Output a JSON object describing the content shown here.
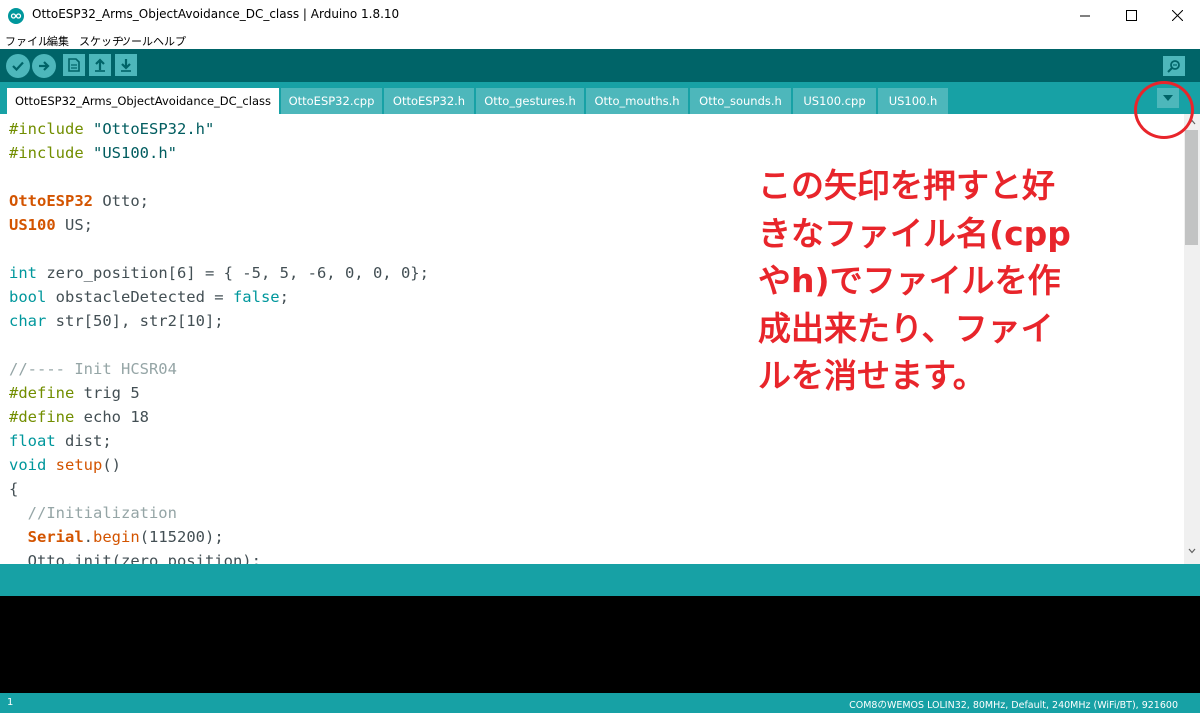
{
  "window": {
    "title": "OttoESP32_Arms_ObjectAvoidance_DC_class | Arduino 1.8.10",
    "app_icon": "arduino-logo-icon",
    "controls": [
      "minimize-icon",
      "maximize-icon",
      "close-icon"
    ]
  },
  "menu": {
    "items": [
      "ファイル",
      "編集",
      "スケッチ",
      "ツール",
      "ヘルプ"
    ]
  },
  "toolbar": {
    "buttons": [
      "verify-icon",
      "upload-icon",
      "new-icon",
      "open-icon",
      "save-icon"
    ],
    "right_button": "serial-monitor-icon"
  },
  "tabs": {
    "items": [
      "OttoESP32_Arms_ObjectAvoidance_DC_class",
      "OttoESP32.cpp",
      "OttoESP32.h",
      "Otto_gestures.h",
      "Otto_mouths.h",
      "Otto_sounds.h",
      "US100.cpp",
      "US100.h"
    ],
    "active_index": 0,
    "menu_icon": "tab-dropdown-icon"
  },
  "code": {
    "lines": [
      "#include \"OttoESP32.h\"",
      "#include \"US100.h\"",
      "",
      "OttoESP32 Otto;",
      "US100 US;",
      "",
      "int zero_position[6] = { -5, 5, -6, 0, 0, 0};",
      "bool obstacleDetected = false;",
      "char str[50], str2[10];",
      "",
      "//---- Init HCSR04",
      "#define trig 5",
      "#define echo 18",
      "float dist;",
      "void setup()",
      "{",
      "  //Initialization",
      "  Serial.begin(115200);",
      "  Otto.init(zero_position);"
    ]
  },
  "annotation": {
    "lines": [
      "この矢印を押すと好",
      "きなファイル名(cpp",
      "やh)でファイルを作",
      "成出来たり、ファイ",
      "ルを消せます。"
    ],
    "color": "#e8252b"
  },
  "footer": {
    "line_number": "1",
    "board_info": "COM8のWEMOS LOLIN32, 80MHz, Default, 240MHz (WiFi/BT), 921600"
  },
  "colors": {
    "toolbar": "#006468",
    "tabbar": "#17a1a5",
    "tab_inactive": "#4db7bb",
    "console": "#000000"
  }
}
